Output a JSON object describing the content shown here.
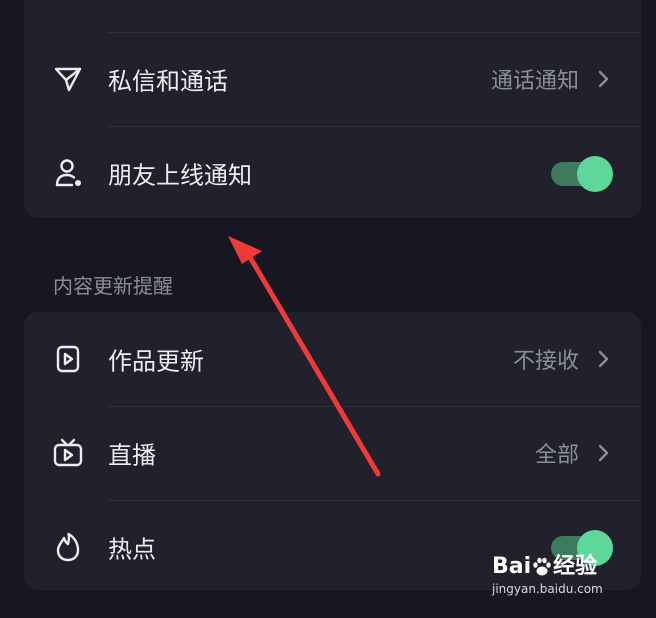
{
  "sections": {
    "top": {
      "items": [
        {
          "label": "私信和通话",
          "value": "通话通知",
          "icon": "paper-plane-icon",
          "type": "link"
        },
        {
          "label": "朋友上线通知",
          "icon": "user-online-icon",
          "type": "toggle",
          "on": true
        }
      ]
    },
    "content_updates": {
      "header": "内容更新提醒",
      "items": [
        {
          "label": "作品更新",
          "value": "不接收",
          "icon": "video-play-icon",
          "type": "link"
        },
        {
          "label": "直播",
          "value": "全部",
          "icon": "tv-live-icon",
          "type": "link"
        },
        {
          "label": "热点",
          "icon": "flame-icon",
          "type": "toggle",
          "on": true
        }
      ]
    }
  },
  "watermark": {
    "brand_left": "Bai",
    "brand_right": "经验",
    "url": "jingyan.baidu.com"
  },
  "colors": {
    "background": "#161722",
    "card": "#20212C",
    "toggle_on": "#5DD79A",
    "annotation_arrow": "#F03A3A"
  }
}
